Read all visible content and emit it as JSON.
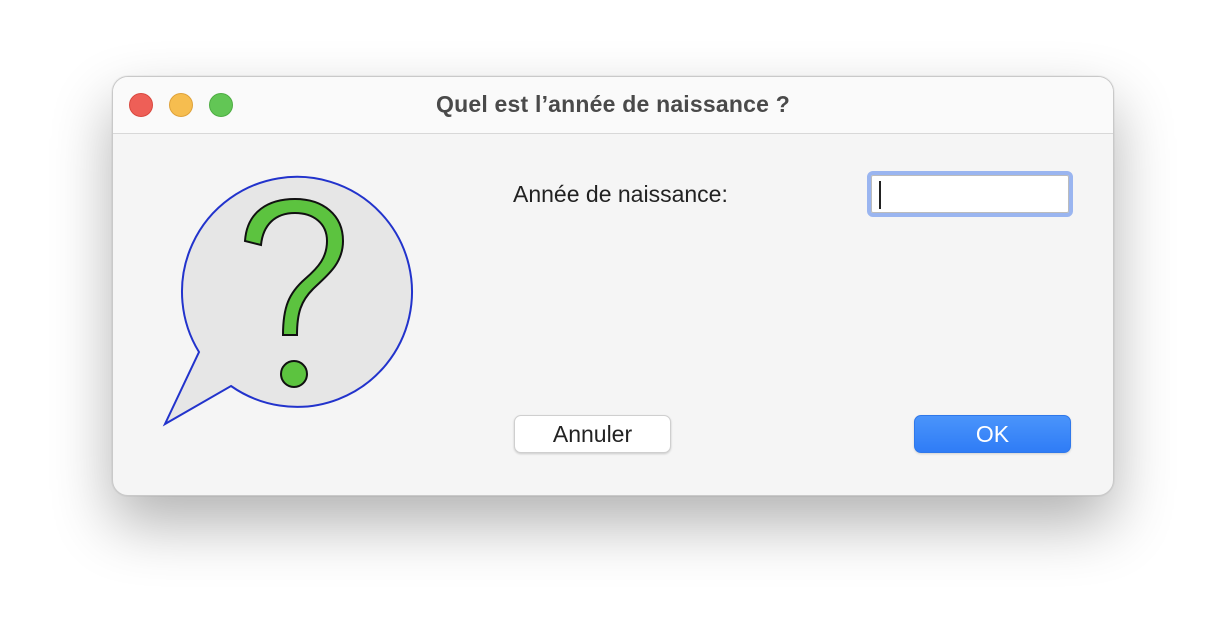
{
  "window": {
    "title": "Quel est l’année de naissance ?"
  },
  "dialog": {
    "icon": "question-speech-bubble-icon",
    "field_label": "Année de naissance:",
    "year_value": "",
    "year_placeholder": "",
    "cancel_label": "Annuler",
    "ok_label": "OK"
  },
  "colors": {
    "accent": "#2f7cf6",
    "focus_ring": "#9ab5f0",
    "close": "#ee5f57",
    "minimize": "#f6bd4f",
    "zoom": "#62c655",
    "question_mark": "#5cc33f",
    "bubble_fill": "#e6e6e6",
    "bubble_stroke": "#2233cc"
  }
}
